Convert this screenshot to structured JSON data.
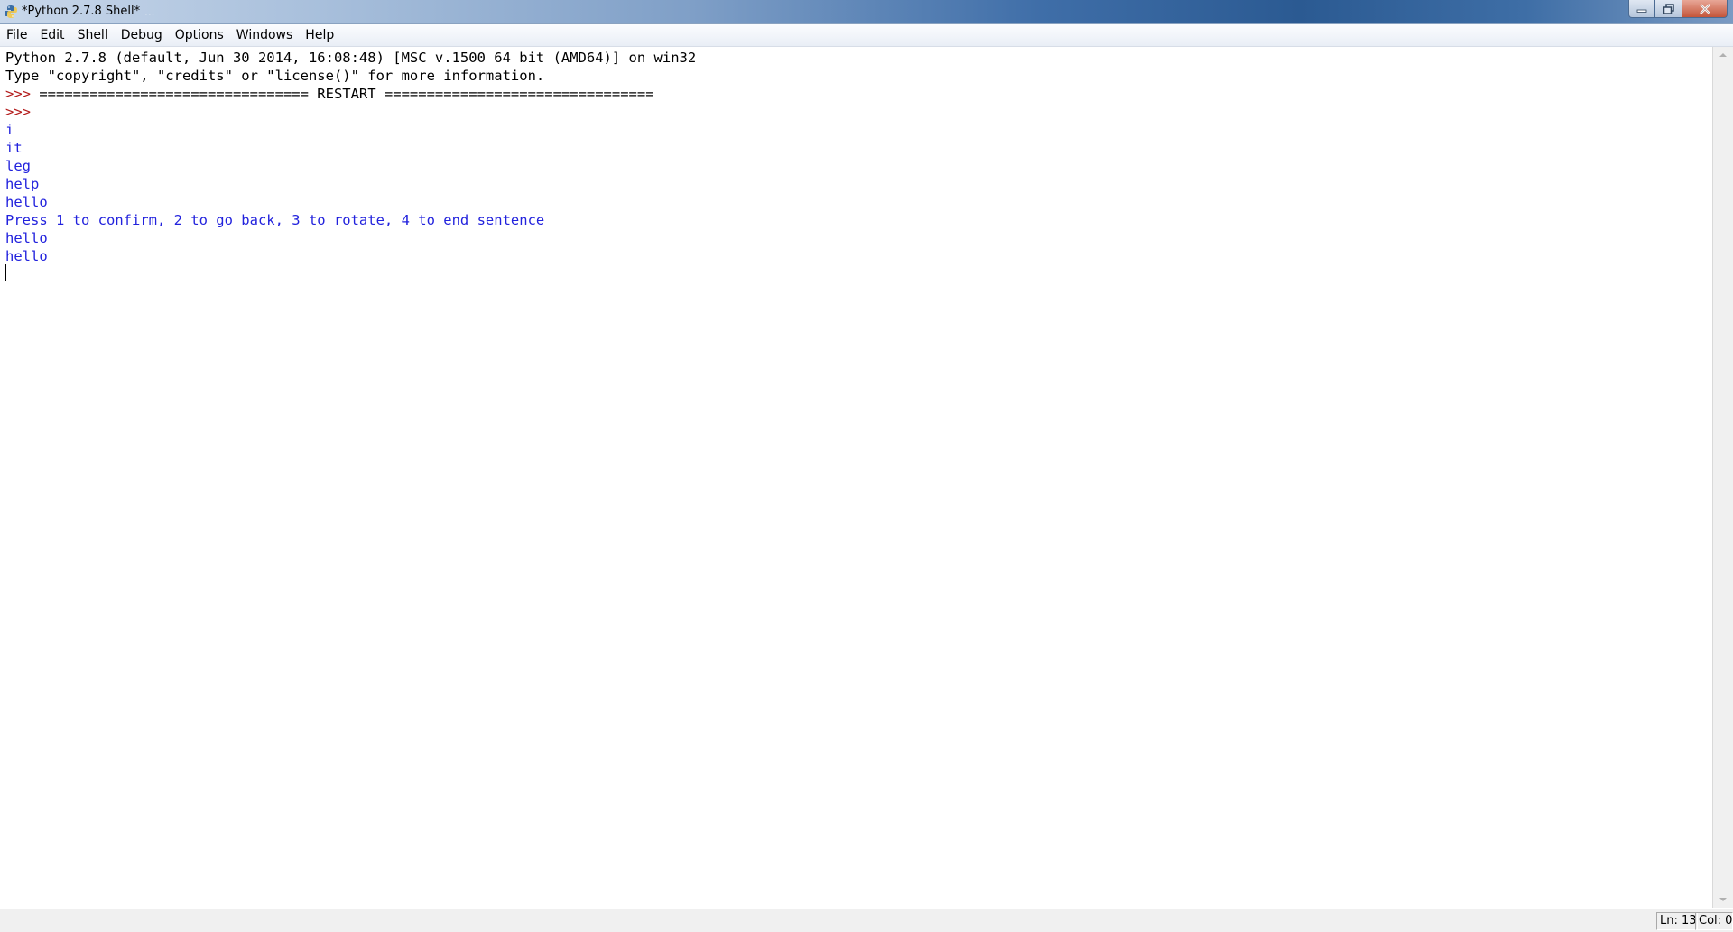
{
  "window": {
    "title": "*Python 2.7.8 Shell*",
    "title_background_text": "...",
    "buttons": {
      "minimize_icon": "minimize-icon",
      "maximize_icon": "restore-icon",
      "close_icon": "close-icon"
    }
  },
  "menu": {
    "items": [
      "File",
      "Edit",
      "Shell",
      "Debug",
      "Options",
      "Windows",
      "Help"
    ]
  },
  "shell": {
    "lines": [
      {
        "text": "Python 2.7.8 (default, Jun 30 2014, 16:08:48) [MSC v.1500 64 bit (AMD64)] on win32",
        "color": "black"
      },
      {
        "text": "Type \"copyright\", \"credits\" or \"license()\" for more information.",
        "color": "black"
      },
      {
        "prompt": ">>> ",
        "text": "================================ RESTART ================================",
        "color": "black"
      },
      {
        "prompt": ">>>",
        "text": "",
        "color": "black"
      },
      {
        "text": "i",
        "color": "blue"
      },
      {
        "text": "it",
        "color": "blue"
      },
      {
        "text": "leg",
        "color": "blue"
      },
      {
        "text": "help",
        "color": "blue"
      },
      {
        "text": "hello",
        "color": "blue"
      },
      {
        "text": "Press 1 to confirm, 2 to go back, 3 to rotate, 4 to end sentence",
        "color": "blue"
      },
      {
        "text": "hello",
        "color": "blue"
      },
      {
        "text": "hello",
        "color": "blue"
      }
    ]
  },
  "status": {
    "line": "Ln: 13",
    "col": "Col: 0"
  },
  "colors": {
    "output_blue": "#2222dd",
    "prompt_red": "#b31b1b",
    "text_black": "#000000"
  }
}
